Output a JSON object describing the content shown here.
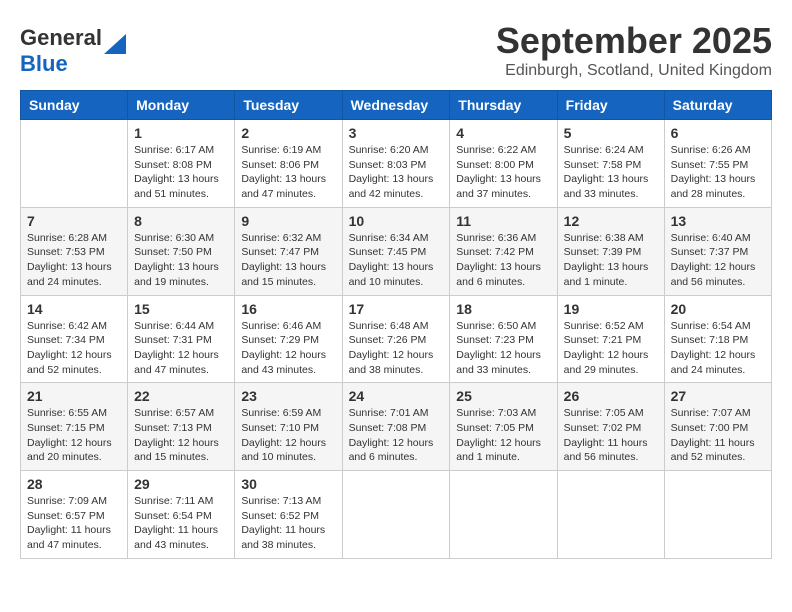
{
  "header": {
    "logo_general": "General",
    "logo_blue": "Blue",
    "month": "September 2025",
    "location": "Edinburgh, Scotland, United Kingdom"
  },
  "weekdays": [
    "Sunday",
    "Monday",
    "Tuesday",
    "Wednesday",
    "Thursday",
    "Friday",
    "Saturday"
  ],
  "weeks": [
    [
      {
        "day": "",
        "info": ""
      },
      {
        "day": "1",
        "info": "Sunrise: 6:17 AM\nSunset: 8:08 PM\nDaylight: 13 hours\nand 51 minutes."
      },
      {
        "day": "2",
        "info": "Sunrise: 6:19 AM\nSunset: 8:06 PM\nDaylight: 13 hours\nand 47 minutes."
      },
      {
        "day": "3",
        "info": "Sunrise: 6:20 AM\nSunset: 8:03 PM\nDaylight: 13 hours\nand 42 minutes."
      },
      {
        "day": "4",
        "info": "Sunrise: 6:22 AM\nSunset: 8:00 PM\nDaylight: 13 hours\nand 37 minutes."
      },
      {
        "day": "5",
        "info": "Sunrise: 6:24 AM\nSunset: 7:58 PM\nDaylight: 13 hours\nand 33 minutes."
      },
      {
        "day": "6",
        "info": "Sunrise: 6:26 AM\nSunset: 7:55 PM\nDaylight: 13 hours\nand 28 minutes."
      }
    ],
    [
      {
        "day": "7",
        "info": "Sunrise: 6:28 AM\nSunset: 7:53 PM\nDaylight: 13 hours\nand 24 minutes."
      },
      {
        "day": "8",
        "info": "Sunrise: 6:30 AM\nSunset: 7:50 PM\nDaylight: 13 hours\nand 19 minutes."
      },
      {
        "day": "9",
        "info": "Sunrise: 6:32 AM\nSunset: 7:47 PM\nDaylight: 13 hours\nand 15 minutes."
      },
      {
        "day": "10",
        "info": "Sunrise: 6:34 AM\nSunset: 7:45 PM\nDaylight: 13 hours\nand 10 minutes."
      },
      {
        "day": "11",
        "info": "Sunrise: 6:36 AM\nSunset: 7:42 PM\nDaylight: 13 hours\nand 6 minutes."
      },
      {
        "day": "12",
        "info": "Sunrise: 6:38 AM\nSunset: 7:39 PM\nDaylight: 13 hours\nand 1 minute."
      },
      {
        "day": "13",
        "info": "Sunrise: 6:40 AM\nSunset: 7:37 PM\nDaylight: 12 hours\nand 56 minutes."
      }
    ],
    [
      {
        "day": "14",
        "info": "Sunrise: 6:42 AM\nSunset: 7:34 PM\nDaylight: 12 hours\nand 52 minutes."
      },
      {
        "day": "15",
        "info": "Sunrise: 6:44 AM\nSunset: 7:31 PM\nDaylight: 12 hours\nand 47 minutes."
      },
      {
        "day": "16",
        "info": "Sunrise: 6:46 AM\nSunset: 7:29 PM\nDaylight: 12 hours\nand 43 minutes."
      },
      {
        "day": "17",
        "info": "Sunrise: 6:48 AM\nSunset: 7:26 PM\nDaylight: 12 hours\nand 38 minutes."
      },
      {
        "day": "18",
        "info": "Sunrise: 6:50 AM\nSunset: 7:23 PM\nDaylight: 12 hours\nand 33 minutes."
      },
      {
        "day": "19",
        "info": "Sunrise: 6:52 AM\nSunset: 7:21 PM\nDaylight: 12 hours\nand 29 minutes."
      },
      {
        "day": "20",
        "info": "Sunrise: 6:54 AM\nSunset: 7:18 PM\nDaylight: 12 hours\nand 24 minutes."
      }
    ],
    [
      {
        "day": "21",
        "info": "Sunrise: 6:55 AM\nSunset: 7:15 PM\nDaylight: 12 hours\nand 20 minutes."
      },
      {
        "day": "22",
        "info": "Sunrise: 6:57 AM\nSunset: 7:13 PM\nDaylight: 12 hours\nand 15 minutes."
      },
      {
        "day": "23",
        "info": "Sunrise: 6:59 AM\nSunset: 7:10 PM\nDaylight: 12 hours\nand 10 minutes."
      },
      {
        "day": "24",
        "info": "Sunrise: 7:01 AM\nSunset: 7:08 PM\nDaylight: 12 hours\nand 6 minutes."
      },
      {
        "day": "25",
        "info": "Sunrise: 7:03 AM\nSunset: 7:05 PM\nDaylight: 12 hours\nand 1 minute."
      },
      {
        "day": "26",
        "info": "Sunrise: 7:05 AM\nSunset: 7:02 PM\nDaylight: 11 hours\nand 56 minutes."
      },
      {
        "day": "27",
        "info": "Sunrise: 7:07 AM\nSunset: 7:00 PM\nDaylight: 11 hours\nand 52 minutes."
      }
    ],
    [
      {
        "day": "28",
        "info": "Sunrise: 7:09 AM\nSunset: 6:57 PM\nDaylight: 11 hours\nand 47 minutes."
      },
      {
        "day": "29",
        "info": "Sunrise: 7:11 AM\nSunset: 6:54 PM\nDaylight: 11 hours\nand 43 minutes."
      },
      {
        "day": "30",
        "info": "Sunrise: 7:13 AM\nSunset: 6:52 PM\nDaylight: 11 hours\nand 38 minutes."
      },
      {
        "day": "",
        "info": ""
      },
      {
        "day": "",
        "info": ""
      },
      {
        "day": "",
        "info": ""
      },
      {
        "day": "",
        "info": ""
      }
    ]
  ]
}
